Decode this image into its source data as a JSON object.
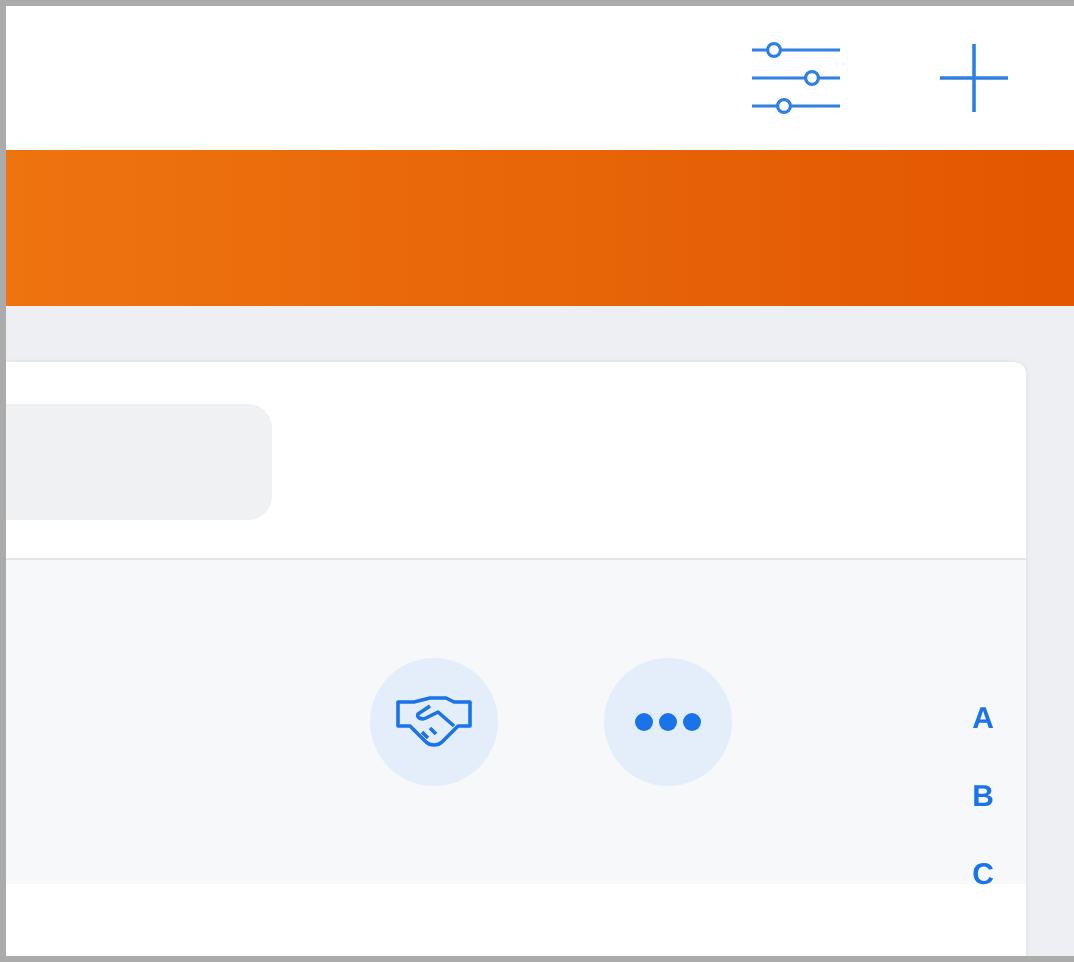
{
  "toolbar": {
    "buttons": [
      {
        "kind": "filter"
      },
      {
        "kind": "add"
      }
    ]
  },
  "actions": [
    {
      "kind": "handshake"
    },
    {
      "kind": "more"
    }
  ],
  "index": [
    "A",
    "B",
    "C"
  ]
}
